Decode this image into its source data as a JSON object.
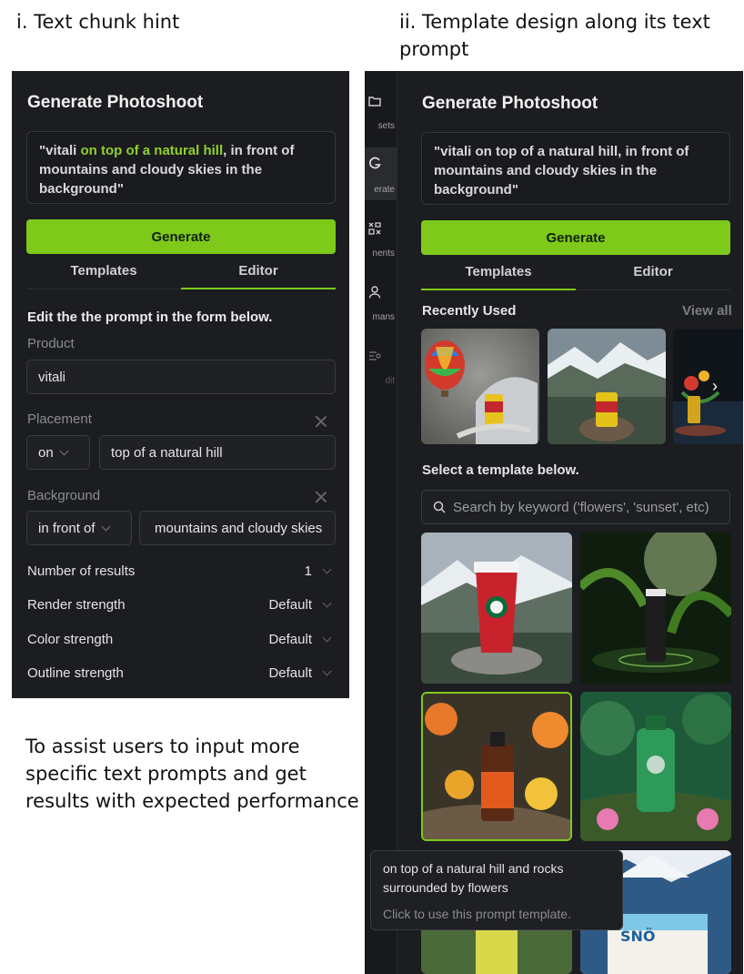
{
  "captions": {
    "left": "i. Text chunk hint",
    "right": "ii. Template design along its text prompt",
    "assist": "To assist users to input more specific text prompts and get results with expected performance"
  },
  "left_panel": {
    "title": "Generate Photoshoot",
    "prompt_q_open": "\"vitali ",
    "prompt_highlight": "on top of a natural hill",
    "prompt_rest": ", in front of mountains and cloudy skies in the background\"",
    "generate_label": "Generate",
    "tabs": [
      "Templates",
      "Editor"
    ],
    "active_tab": "Editor",
    "edit_heading": "Edit the the prompt in the form below.",
    "product_label": "Product",
    "product_value": "vitali",
    "placement_label": "Placement",
    "placement_select": "on",
    "placement_value": "top of a natural hill",
    "background_label": "Background",
    "background_select": "in front of",
    "background_value": "mountains and cloudy skies",
    "options": [
      {
        "label": "Number of results",
        "value": "1"
      },
      {
        "label": "Render strength",
        "value": "Default"
      },
      {
        "label": "Color strength",
        "value": "Default"
      },
      {
        "label": "Outline strength",
        "value": "Default"
      }
    ]
  },
  "right_panel": {
    "sidebar": [
      {
        "label": "sets",
        "icon": "folder-icon"
      },
      {
        "label": "erate",
        "icon": "generate-icon"
      },
      {
        "label": "nents",
        "icon": "elements-icon"
      },
      {
        "label": "mans",
        "icon": "human-icon"
      },
      {
        "label": "dit",
        "icon": "edit-icon"
      }
    ],
    "title": "Generate Photoshoot",
    "prompt": "\"vitali on top of a natural hill, in front of mountains and cloudy skies in the background\"",
    "generate_label": "Generate",
    "tabs": [
      "Templates",
      "Editor"
    ],
    "active_tab": "Templates",
    "recently_used": "Recently Used",
    "view_all": "View all",
    "select_template": "Select a template below.",
    "search_placeholder": "Search by keyword ('flowers', 'sunset', etc)",
    "tooltip_text": "on top of a natural hill and rocks surrounded by flowers",
    "tooltip_sub": "Click to use this prompt template."
  },
  "colors": {
    "accent": "#7ec91a",
    "panel": "#1c1d20"
  }
}
